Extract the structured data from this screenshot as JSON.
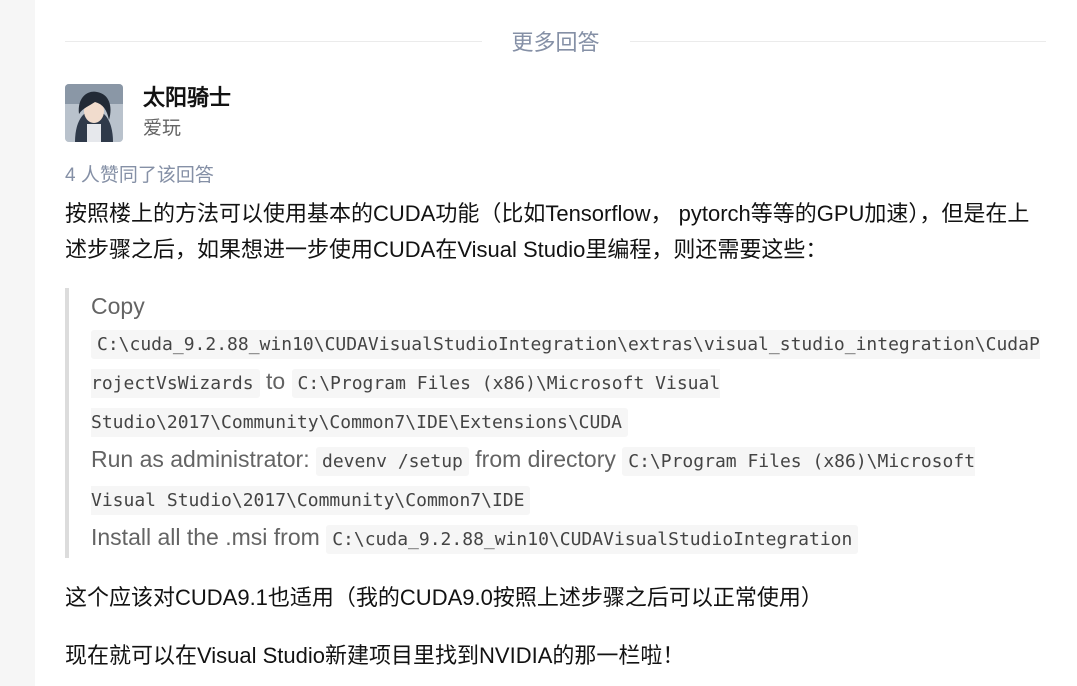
{
  "section": {
    "divider_label": "更多回答"
  },
  "author": {
    "name": "太阳骑士",
    "bio": "爱玩"
  },
  "answer": {
    "votes": "4 人赞同了该回答",
    "intro": "按照楼上的方法可以使用基本的CUDA功能（比如Tensorflow， pytorch等等的GPU加速），但是在上述步骤之后，如果想进一步使用CUDA在Visual Studio里编程，则还需要这些：",
    "quote": {
      "copy_label": "Copy",
      "copy_src": "C:\\cuda_9.2.88_win10\\CUDAVisualStudioIntegration\\extras\\visual_studio_integration\\CudaProjectVsWizards",
      "to_word": "to",
      "copy_dest": "C:\\Program Files (x86)\\Microsoft Visual Studio\\2017\\Community\\Common7\\IDE\\Extensions\\CUDA",
      "run_label": "Run as administrator:",
      "run_cmd": "devenv /setup",
      "from_dir_label": "from directory",
      "run_dir": "C:\\Program Files (x86)\\Microsoft Visual Studio\\2017\\Community\\Common7\\IDE",
      "install_label": "Install all the .msi from",
      "install_dir": "C:\\cuda_9.2.88_win10\\CUDAVisualStudioIntegration"
    },
    "note1": "这个应该对CUDA9.1也适用（我的CUDA9.0按照上述步骤之后可以正常使用）",
    "note2": "现在就可以在Visual Studio新建项目里找到NVIDIA的那一栏啦！"
  }
}
